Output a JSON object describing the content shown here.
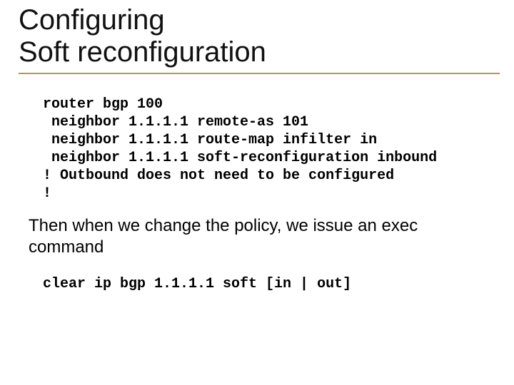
{
  "title": {
    "line1": "Configuring",
    "line2": "Soft reconfiguration"
  },
  "code_block": {
    "l1": "router bgp 100",
    "l2": " neighbor 1.1.1.1 remote-as 101",
    "l3": " neighbor 1.1.1.1 route-map infilter in",
    "l4": " neighbor 1.1.1.1 soft-reconfiguration inbound",
    "l5": "! Outbound does not need to be configured",
    "l6": "!"
  },
  "paragraph": "Then when we change the policy, we issue an exec command",
  "code_block2": {
    "l1": "clear ip bgp 1.1.1.1 soft [in | out]"
  }
}
